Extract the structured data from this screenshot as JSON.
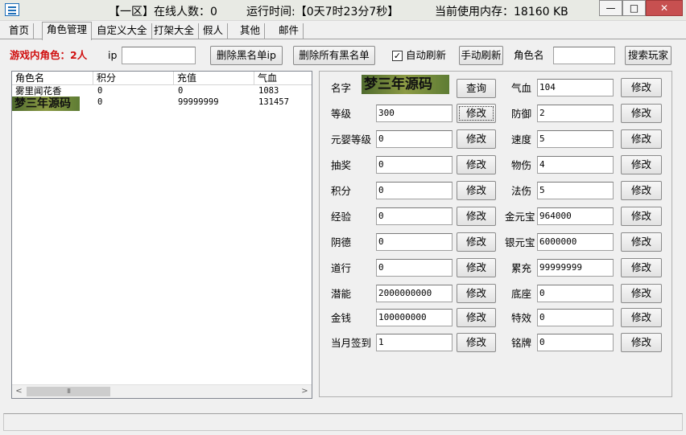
{
  "titlebar": {
    "server": "【一区】在线人数：0",
    "runtime": "运行时间:【0天7时23分7秒】",
    "memory": "当前使用内存：18160 KB",
    "minimize": "—",
    "maximize": "□",
    "close": "✕"
  },
  "tabs": [
    "首页",
    "角色管理",
    "自定义大全",
    "打架大全",
    "假人",
    "其他",
    "邮件"
  ],
  "toolbar": {
    "online_roles": "游戏内角色：2人",
    "ip_label": "ip",
    "ip_value": "",
    "delete_blacklist_ip": "删除黑名单ip",
    "delete_all_blacklist": "删除所有黑名单",
    "auto_refresh_label": "自动刷新",
    "auto_refresh_checked": true,
    "manual_refresh": "手动刷新",
    "role_name_label": "角色名",
    "role_name_value": "",
    "search_player": "搜索玩家"
  },
  "table": {
    "columns": [
      "角色名",
      "积分",
      "充值",
      "气血"
    ],
    "rows": [
      [
        "雾里闻花香",
        "0",
        "0",
        "1083"
      ],
      [
        "梦三年源码",
        "0",
        "99999999",
        "131457"
      ]
    ],
    "hscroll_thumb": "III",
    "left_arrow": "<",
    "right_arrow": ">"
  },
  "detail": {
    "name_label": "名字",
    "name_value": "梦三年源码",
    "query_button": "查询",
    "edit_label": "修改",
    "left_fields": [
      {
        "label": "等级",
        "value": "300"
      },
      {
        "label": "元婴等级",
        "value": "0"
      },
      {
        "label": "抽奖",
        "value": "0"
      },
      {
        "label": "积分",
        "value": "0"
      },
      {
        "label": "经验",
        "value": "0"
      },
      {
        "label": "阴德",
        "value": "0"
      },
      {
        "label": "道行",
        "value": "0"
      },
      {
        "label": "潜能",
        "value": "2000000000"
      },
      {
        "label": "金钱",
        "value": "100000000"
      },
      {
        "label": "当月签到",
        "value": "1"
      }
    ],
    "right_fields": [
      {
        "label": "气血",
        "value": "104"
      },
      {
        "label": "防御",
        "value": "2"
      },
      {
        "label": "速度",
        "value": "5"
      },
      {
        "label": "物伤",
        "value": "4"
      },
      {
        "label": "法伤",
        "value": "5"
      },
      {
        "label": "金元宝",
        "value": "964000"
      },
      {
        "label": "银元宝",
        "value": "6000000"
      },
      {
        "label": "累充",
        "value": "99999999"
      },
      {
        "label": "底座",
        "value": "0"
      },
      {
        "label": "特效",
        "value": "0"
      },
      {
        "label": "铭牌",
        "value": "0"
      }
    ]
  }
}
